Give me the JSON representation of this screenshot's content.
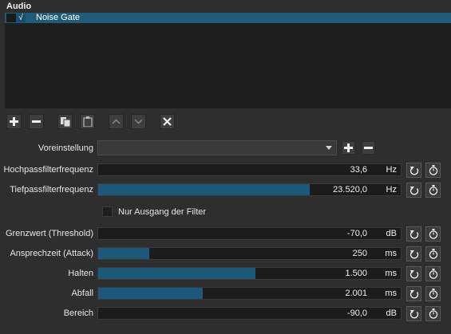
{
  "panel": {
    "title": "Audio"
  },
  "filters": [
    {
      "checked": "√",
      "name": "Noise Gate"
    }
  ],
  "toolbar": {
    "buttons": [
      "plus-icon",
      "minus-icon",
      "copy-icon",
      "paste-icon",
      "up-icon",
      "down-icon",
      "close-icon"
    ]
  },
  "preset": {
    "label": "Voreinstellung",
    "value": ""
  },
  "params": [
    {
      "label": "Hochpassfilterfrequenz",
      "value": "33,6",
      "unit": "Hz",
      "level": 0.0
    },
    {
      "label": "Tiefpassfilterfrequenz",
      "value": "23.520,0",
      "unit": "Hz",
      "level": 0.7
    },
    {
      "label": "Grenzwert (Threshold)",
      "value": "-70,0",
      "unit": "dB",
      "level": 0.0
    },
    {
      "label": "Ansprechzeit (Attack)",
      "value": "250",
      "unit": "ms",
      "level": 0.17
    },
    {
      "label": "Halten",
      "value": "1.500",
      "unit": "ms",
      "level": 0.52
    },
    {
      "label": "Abfall",
      "value": "2.001",
      "unit": "ms",
      "level": 0.345
    },
    {
      "label": "Bereich",
      "value": "-90,0",
      "unit": "dB",
      "level": 0.0
    }
  ],
  "output_only": {
    "label": "Nur Ausgang der Filter",
    "checked": false
  },
  "colors": {
    "accent": "#1c5878",
    "selection": "#1f5b7b",
    "background": "#2e2e2e"
  }
}
